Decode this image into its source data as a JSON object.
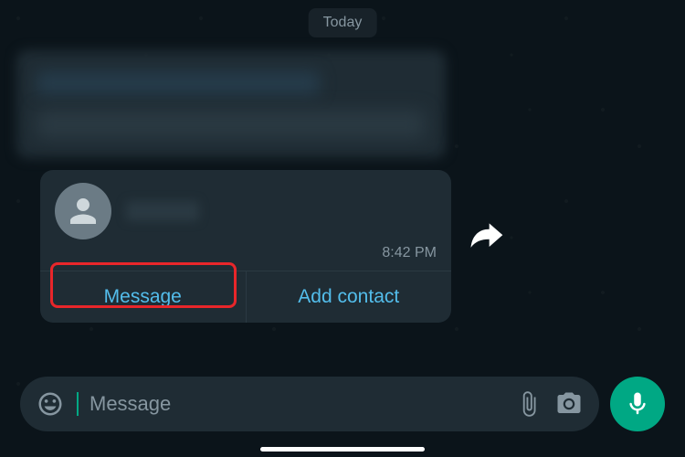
{
  "date_label": "Today",
  "contact_card": {
    "timestamp": "8:42 PM",
    "actions": {
      "message": "Message",
      "add_contact": "Add contact"
    }
  },
  "input": {
    "placeholder": "Message"
  }
}
